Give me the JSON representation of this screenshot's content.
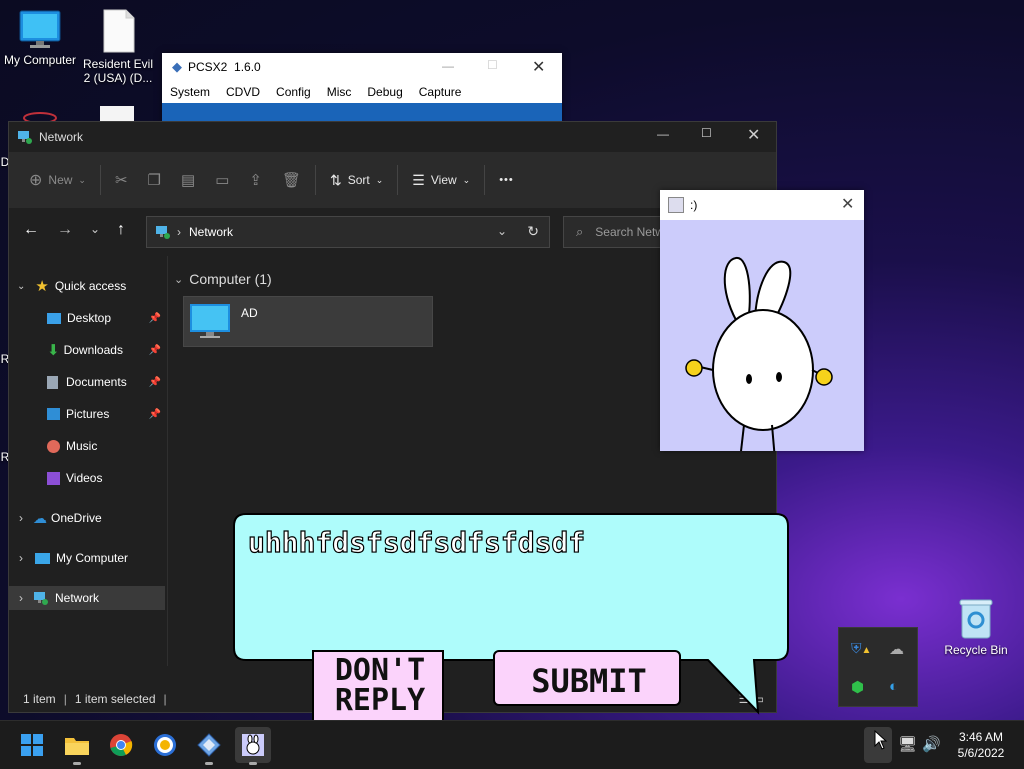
{
  "desktop": {
    "icons": {
      "my_computer": "My Computer",
      "resident_evil": "Resident Evil 2 (USA) (D...",
      "recycle_bin": "Recycle Bin"
    },
    "edge_letters": [
      "D",
      "R",
      "R"
    ]
  },
  "pcsx2": {
    "title": "PCSX2  1.6.0",
    "menu": [
      "System",
      "CDVD",
      "Config",
      "Misc",
      "Debug",
      "Capture"
    ]
  },
  "explorer": {
    "title": "Network",
    "toolbar": {
      "new": "New",
      "sort": "Sort",
      "view": "View",
      "more": "•••"
    },
    "address": {
      "path": "Network",
      "search_placeholder": "Search Netw"
    },
    "nav": {
      "quick_access": "Quick access",
      "desktop": "Desktop",
      "downloads": "Downloads",
      "documents": "Documents",
      "pictures": "Pictures",
      "music": "Music",
      "videos": "Videos",
      "onedrive": "OneDrive",
      "my_computer": "My Computer",
      "network": "Network"
    },
    "content": {
      "group_header": "Computer (1)",
      "item_name": "AD"
    },
    "status": {
      "count": "1 item",
      "selected": "1 item selected"
    }
  },
  "smiley_window": {
    "title": ":)"
  },
  "bubble": {
    "text": "uhhhfdsfsdfsdfsfdsdf",
    "dont_reply": "DON'T REPLY",
    "submit": "SUBMIT"
  },
  "taskbar": {
    "time": "3:46 AM",
    "date": "5/6/2022"
  },
  "colors": {
    "explorer_bg": "#202020",
    "bubble_fill": "#aefcfb",
    "button_fill": "#fbd3fb",
    "rabbit_canvas": "#ccccfb",
    "accent_blue": "#2a8fd8"
  }
}
